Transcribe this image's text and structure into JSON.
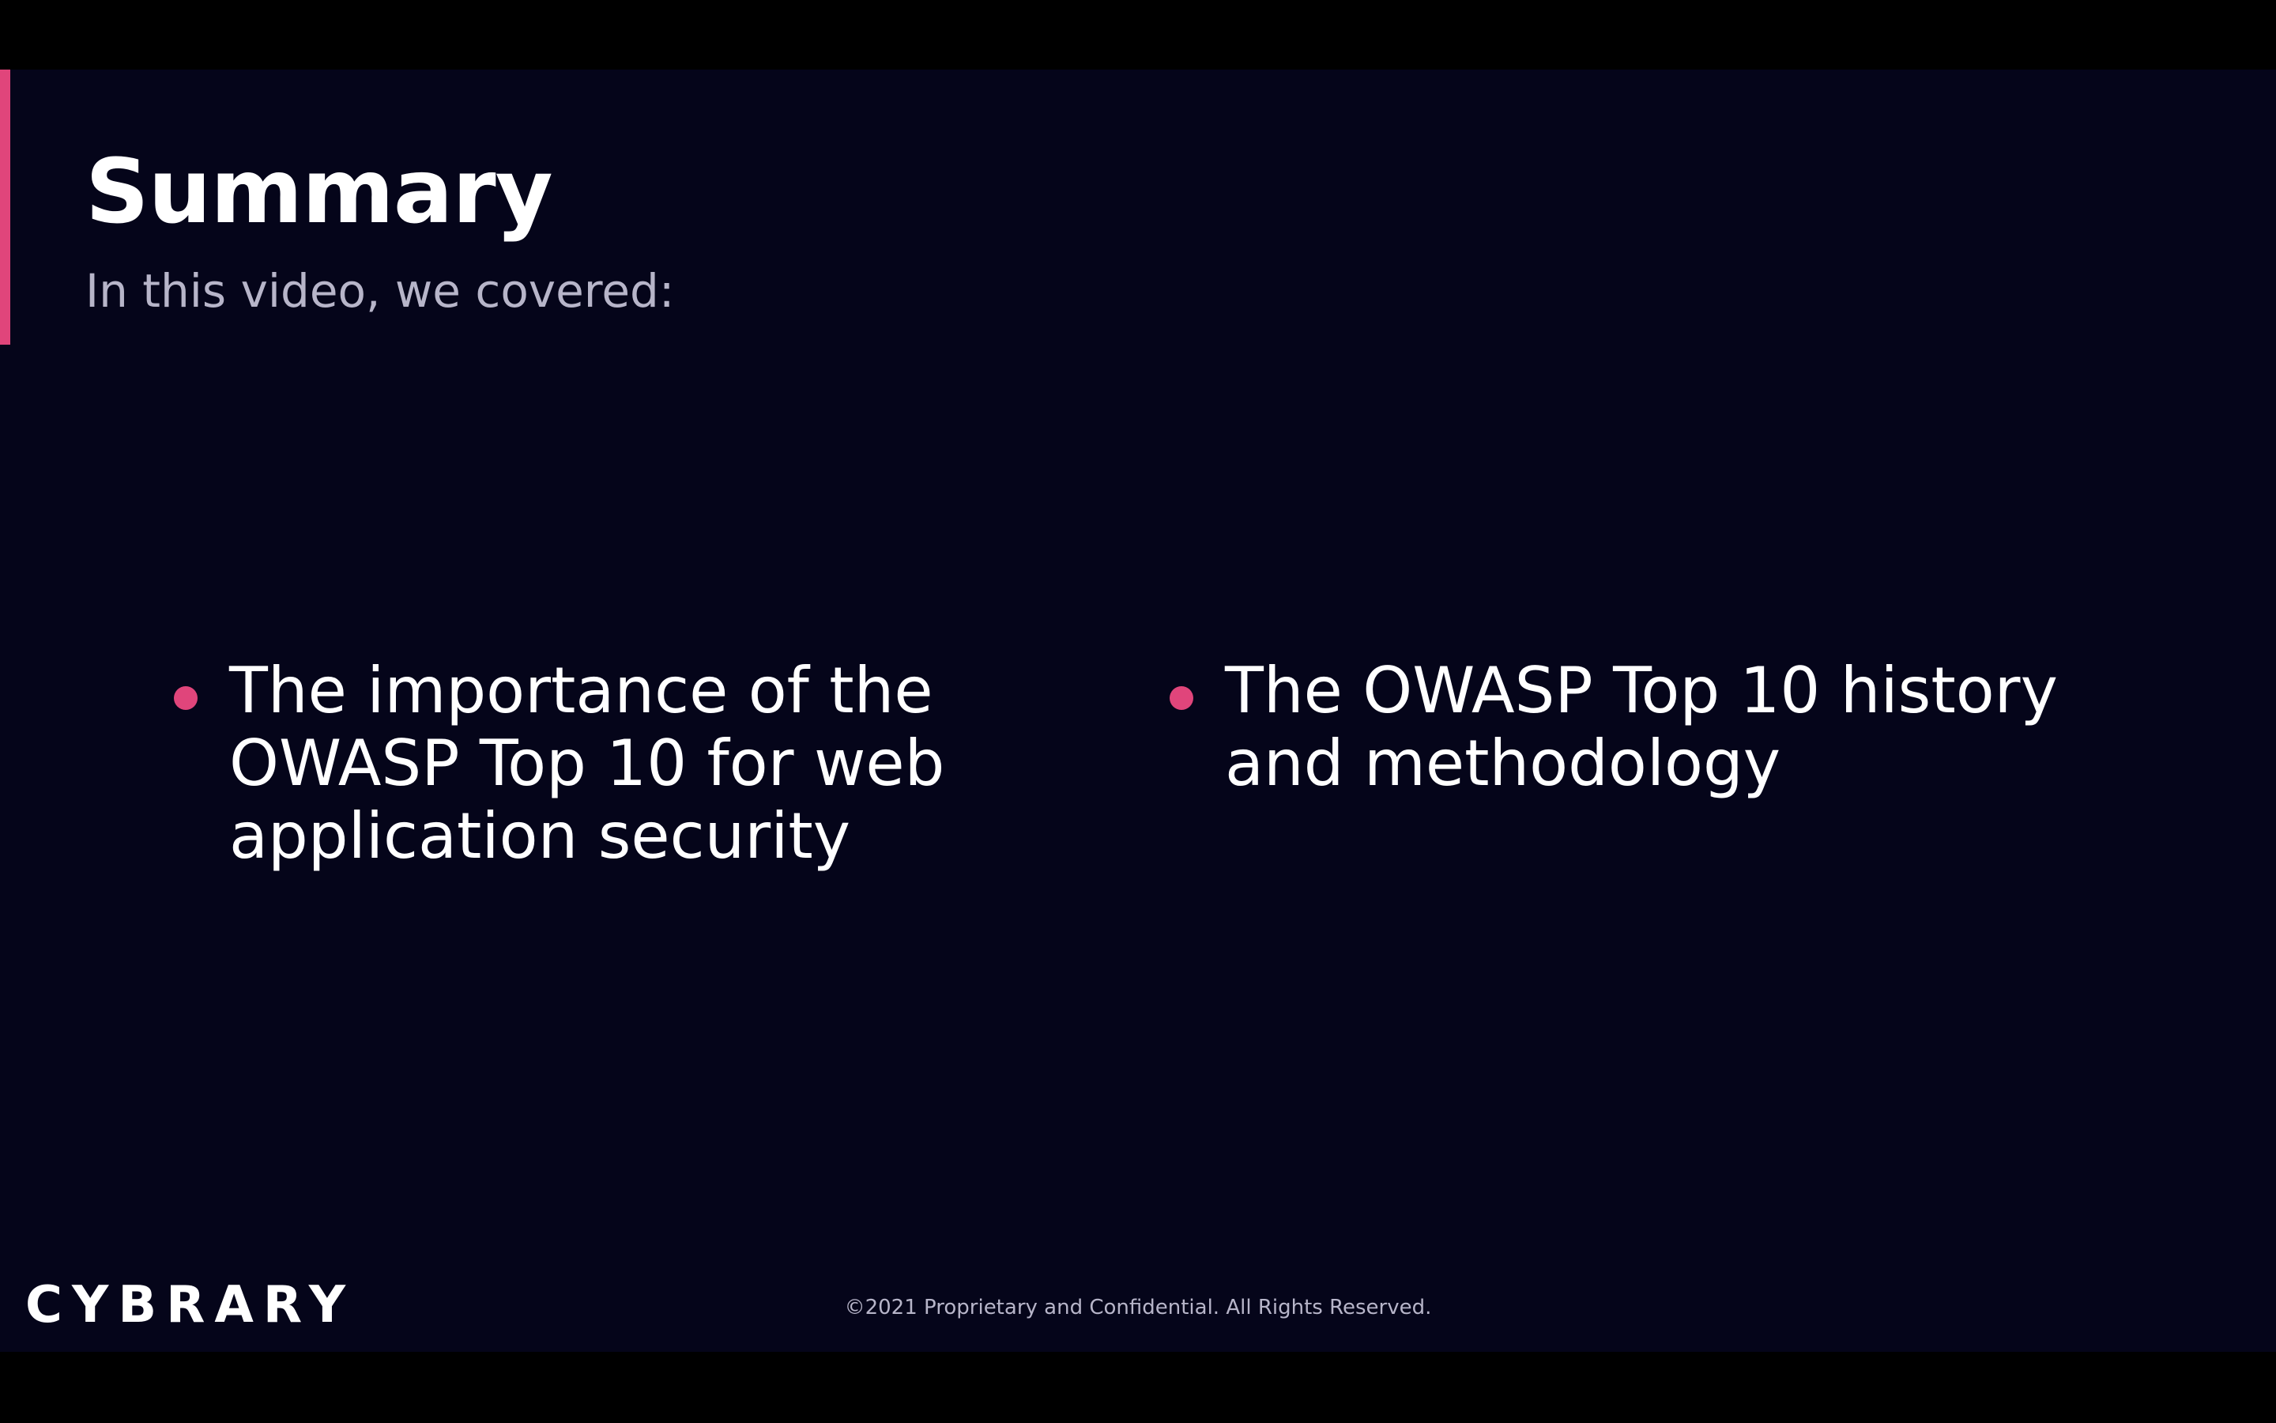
{
  "slide": {
    "title": "Summary",
    "subtitle": "In this video, we covered:",
    "bullets": [
      "The importance of the OWASP Top 10 for web application security",
      "The OWASP Top 10 history and methodology"
    ],
    "footer": "©2021 Proprietary and Confidential. All Rights Reserved.",
    "logo": "CYBRARY"
  },
  "colors": {
    "background": "#05051a",
    "accent": "#e0457b",
    "text": "#ffffff",
    "muted_text": "#b7b5c9"
  }
}
